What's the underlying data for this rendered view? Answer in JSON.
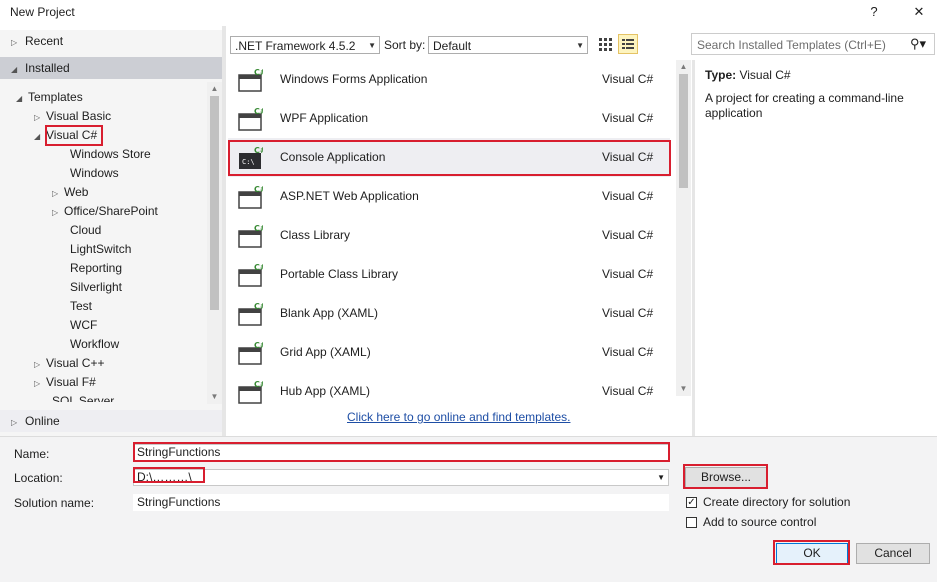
{
  "window": {
    "title": "New Project",
    "help": "?",
    "close": "✕"
  },
  "sidebar": {
    "recent": "Recent",
    "installed": "Installed",
    "online": "Online",
    "tree": [
      {
        "label": "Templates",
        "caret": "◢"
      },
      {
        "label": "Visual Basic",
        "caret": "▷"
      },
      {
        "label": "Visual C#",
        "caret": "◢"
      },
      {
        "label": "Windows Store",
        "caret": ""
      },
      {
        "label": "Windows",
        "caret": ""
      },
      {
        "label": "Web",
        "caret": "▷"
      },
      {
        "label": "Office/SharePoint",
        "caret": "▷"
      },
      {
        "label": "Cloud",
        "caret": ""
      },
      {
        "label": "LightSwitch",
        "caret": ""
      },
      {
        "label": "Reporting",
        "caret": ""
      },
      {
        "label": "Silverlight",
        "caret": ""
      },
      {
        "label": "Test",
        "caret": ""
      },
      {
        "label": "WCF",
        "caret": ""
      },
      {
        "label": "Workflow",
        "caret": ""
      },
      {
        "label": "Visual C++",
        "caret": "▷"
      },
      {
        "label": "Visual F#",
        "caret": "▷"
      },
      {
        "label": "SQL Server",
        "caret": ""
      }
    ]
  },
  "toolbar": {
    "framework": ".NET Framework 4.5.2",
    "sort_label": "Sort by:",
    "sort_value": "Default",
    "search_placeholder": "Search Installed Templates (Ctrl+E)"
  },
  "templates": [
    {
      "name": "Windows Forms Application",
      "lang": "Visual C#"
    },
    {
      "name": "WPF Application",
      "lang": "Visual C#"
    },
    {
      "name": "Console Application",
      "lang": "Visual C#"
    },
    {
      "name": "ASP.NET Web Application",
      "lang": "Visual C#"
    },
    {
      "name": "Class Library",
      "lang": "Visual C#"
    },
    {
      "name": "Portable Class Library",
      "lang": "Visual C#"
    },
    {
      "name": "Blank App (XAML)",
      "lang": "Visual C#"
    },
    {
      "name": "Grid App (XAML)",
      "lang": "Visual C#"
    },
    {
      "name": "Hub App (XAML)",
      "lang": "Visual C#"
    }
  ],
  "online_link": "Click here to go online and find templates.",
  "details": {
    "type_label": "Type:",
    "type_value": "Visual C#",
    "description": "A project for creating a command-line application"
  },
  "form": {
    "name_label": "Name:",
    "name_value": "StringFunctions",
    "location_label": "Location:",
    "location_value": "D:\\………\\",
    "solution_label": "Solution name:",
    "solution_value": "StringFunctions",
    "browse": "Browse...",
    "create_dir": "Create directory for solution",
    "add_source": "Add to source control",
    "ok": "OK",
    "cancel": "Cancel"
  }
}
